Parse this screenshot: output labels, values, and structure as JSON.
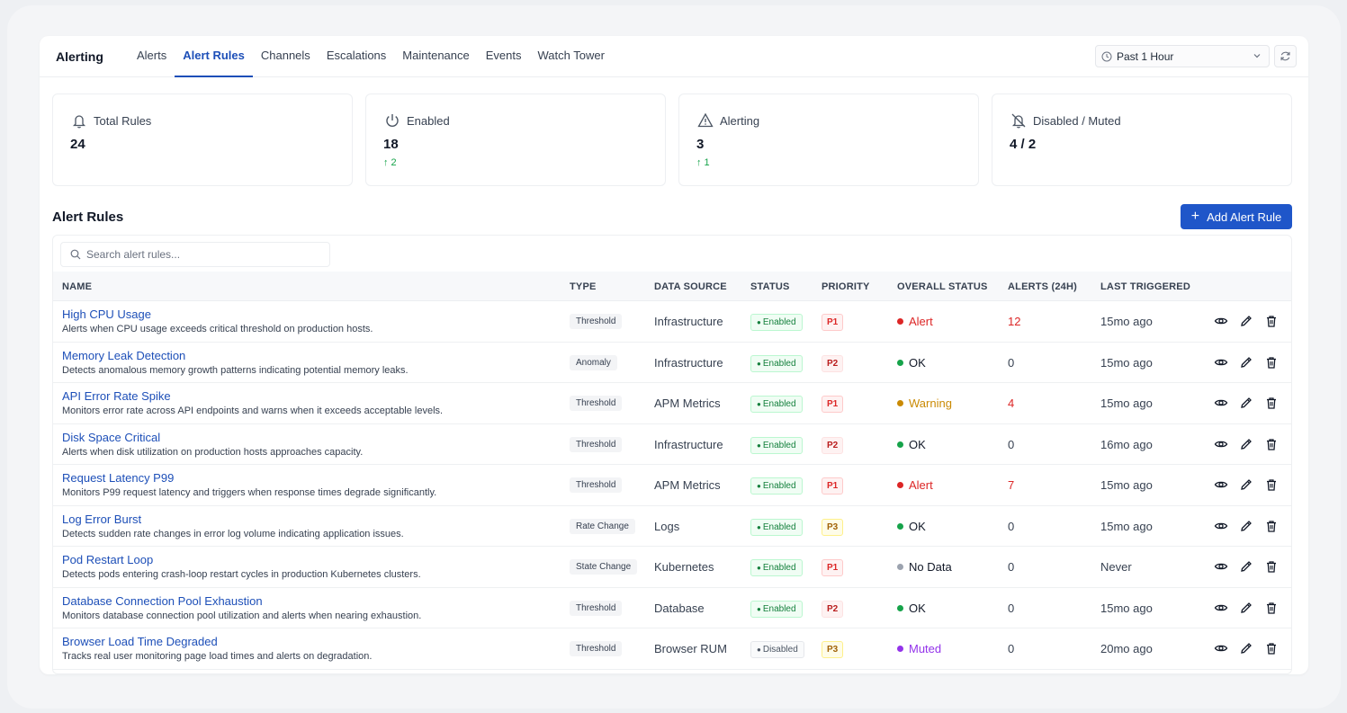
{
  "app": {
    "title": "Alerting",
    "tabs": [
      {
        "label": "Alerts",
        "active": false
      },
      {
        "label": "Alert Rules",
        "active": true
      },
      {
        "label": "Channels",
        "active": false
      },
      {
        "label": "Escalations",
        "active": false
      },
      {
        "label": "Maintenance",
        "active": false
      },
      {
        "label": "Events",
        "active": false
      },
      {
        "label": "Watch Tower",
        "active": false
      }
    ],
    "time_range": "Past 1 Hour"
  },
  "stats": [
    {
      "label": "Total Rules",
      "value": "24",
      "trend": "",
      "icon": "bell-icon"
    },
    {
      "label": "Enabled",
      "value": "18",
      "trend": "↑ 2",
      "icon": "power-icon"
    },
    {
      "label": "Alerting",
      "value": "3",
      "trend": "↑ 1",
      "icon": "warning-triangle-icon"
    },
    {
      "label": "Disabled / Muted",
      "value": "4 / 2",
      "trend": "",
      "icon": "bell-off-icon"
    }
  ],
  "section": {
    "title": "Alert Rules",
    "add_label": "Add Alert Rule"
  },
  "search": {
    "placeholder": "Search alert rules..."
  },
  "columns": [
    "NAME",
    "TYPE",
    "DATA SOURCE",
    "STATUS",
    "PRIORITY",
    "OVERALL STATUS",
    "ALERTS (24H)",
    "LAST TRIGGERED"
  ],
  "colors": {
    "accent": "#1f56c9",
    "alert": "#dc2626",
    "ok": "#16a34a",
    "warning": "#ca8a04",
    "nodata": "#9ca3af",
    "muted": "#9333ea"
  },
  "rows": [
    {
      "name": "High CPU Usage",
      "desc": "Alerts when CPU usage exceeds critical threshold on production hosts.",
      "type": "Threshold",
      "source": "Infrastructure",
      "status": "Enabled",
      "priority": "P1",
      "overall": "Alert",
      "alerts": "12",
      "last": "15mo ago"
    },
    {
      "name": "Memory Leak Detection",
      "desc": "Detects anomalous memory growth patterns indicating potential memory leaks.",
      "type": "Anomaly",
      "source": "Infrastructure",
      "status": "Enabled",
      "priority": "P2",
      "overall": "OK",
      "alerts": "0",
      "last": "15mo ago"
    },
    {
      "name": "API Error Rate Spike",
      "desc": "Monitors error rate across API endpoints and warns when it exceeds acceptable levels.",
      "type": "Threshold",
      "source": "APM Metrics",
      "status": "Enabled",
      "priority": "P1",
      "overall": "Warning",
      "alerts": "4",
      "last": "15mo ago"
    },
    {
      "name": "Disk Space Critical",
      "desc": "Alerts when disk utilization on production hosts approaches capacity.",
      "type": "Threshold",
      "source": "Infrastructure",
      "status": "Enabled",
      "priority": "P2",
      "overall": "OK",
      "alerts": "0",
      "last": "16mo ago"
    },
    {
      "name": "Request Latency P99",
      "desc": "Monitors P99 request latency and triggers when response times degrade significantly.",
      "type": "Threshold",
      "source": "APM Metrics",
      "status": "Enabled",
      "priority": "P1",
      "overall": "Alert",
      "alerts": "7",
      "last": "15mo ago"
    },
    {
      "name": "Log Error Burst",
      "desc": "Detects sudden rate changes in error log volume indicating application issues.",
      "type": "Rate Change",
      "source": "Logs",
      "status": "Enabled",
      "priority": "P3",
      "overall": "OK",
      "alerts": "0",
      "last": "15mo ago"
    },
    {
      "name": "Pod Restart Loop",
      "desc": "Detects pods entering crash-loop restart cycles in production Kubernetes clusters.",
      "type": "State Change",
      "source": "Kubernetes",
      "status": "Enabled",
      "priority": "P1",
      "overall": "No Data",
      "alerts": "0",
      "last": "Never"
    },
    {
      "name": "Database Connection Pool Exhaustion",
      "desc": "Monitors database connection pool utilization and alerts when nearing exhaustion.",
      "type": "Threshold",
      "source": "Database",
      "status": "Enabled",
      "priority": "P2",
      "overall": "OK",
      "alerts": "0",
      "last": "15mo ago"
    },
    {
      "name": "Browser Load Time Degraded",
      "desc": "Tracks real user monitoring page load times and alerts on degradation.",
      "type": "Threshold",
      "source": "Browser RUM",
      "status": "Disabled",
      "priority": "P3",
      "overall": "Muted",
      "alerts": "0",
      "last": "20mo ago"
    }
  ]
}
